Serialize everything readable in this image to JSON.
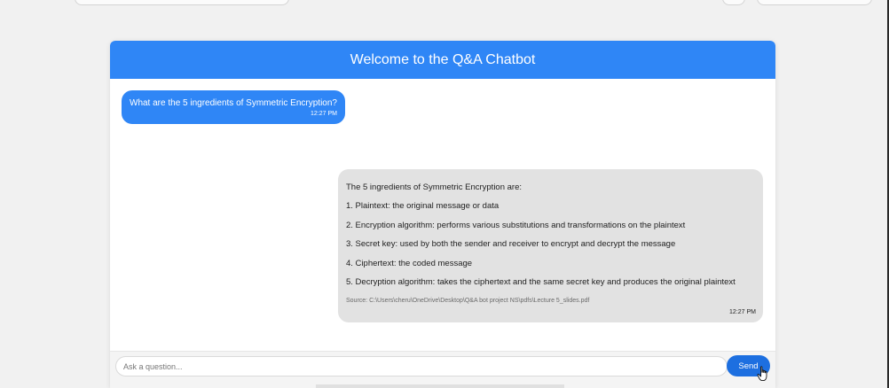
{
  "header": {
    "title": "Welcome to the Q&A Chatbot"
  },
  "messages": {
    "user": {
      "text": "What are the 5 ingredients of Symmetric Encryption?",
      "time": "12:27 PM"
    },
    "bot": {
      "intro": "The 5 ingredients of Symmetric Encryption are:",
      "items": [
        "1. Plaintext: the original message or data",
        "2. Encryption algorithm: performs various substitutions and transformations on the plaintext",
        "3. Secret key: used by both the sender and receiver to encrypt and decrypt the message",
        "4. Ciphertext: the coded message",
        "5. Decryption algorithm: takes the ciphertext and the same secret key and produces the original plaintext"
      ],
      "source": "Source: C:\\Users\\cheru\\OneDrive\\Desktop\\Q&A bot project NS\\pdfs\\Lecture 5_slides.pdf",
      "time": "12:27 PM"
    }
  },
  "input": {
    "placeholder": "Ask a question...",
    "value": ""
  },
  "send_button": {
    "label": "Send"
  },
  "colors": {
    "accent": "#2f86f6",
    "send_button": "#1d6fe0",
    "bot_bubble": "#e2e2e2",
    "page_background": "#f1f1f1"
  },
  "icons": {
    "cursor": "hand-pointer-icon"
  }
}
